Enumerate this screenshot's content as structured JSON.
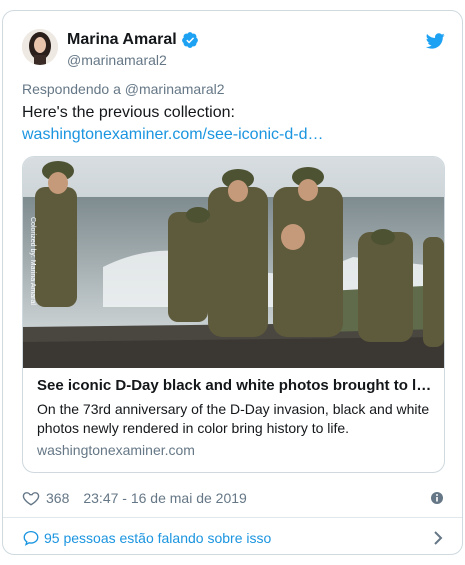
{
  "author": {
    "name": "Marina Amaral",
    "handle": "@marinamaral2",
    "verified": true
  },
  "reply_to": {
    "prefix": "Respondendo a",
    "handle": "@marinamaral2"
  },
  "tweet": {
    "text": "Here's the previous collection:",
    "link_text": "washingtonexaminer.com/see-iconic-d-d…"
  },
  "photo": {
    "watermark": "Colorized by: Marina Amaral"
  },
  "link_preview": {
    "title": "See iconic D-Day black and white photos brought to life i…",
    "description": "On the 73rd anniversary of the D-Day invasion, black and white photos newly rendered in color bring history to life.",
    "domain": "washingtonexaminer.com"
  },
  "meta": {
    "likes": "368",
    "timestamp": "23:47 - 16 de mai de 2019"
  },
  "footer": {
    "conversation_text": "95 pessoas estão falando sobre isso"
  },
  "colors": {
    "link": "#1b95e0",
    "muted": "#657786",
    "border": "#cfd9de",
    "twitter_blue": "#1da1f2"
  },
  "icons": [
    "verified-badge-icon",
    "twitter-bird-icon",
    "heart-icon",
    "info-icon",
    "reply-bubble-icon",
    "chevron-right-icon"
  ]
}
